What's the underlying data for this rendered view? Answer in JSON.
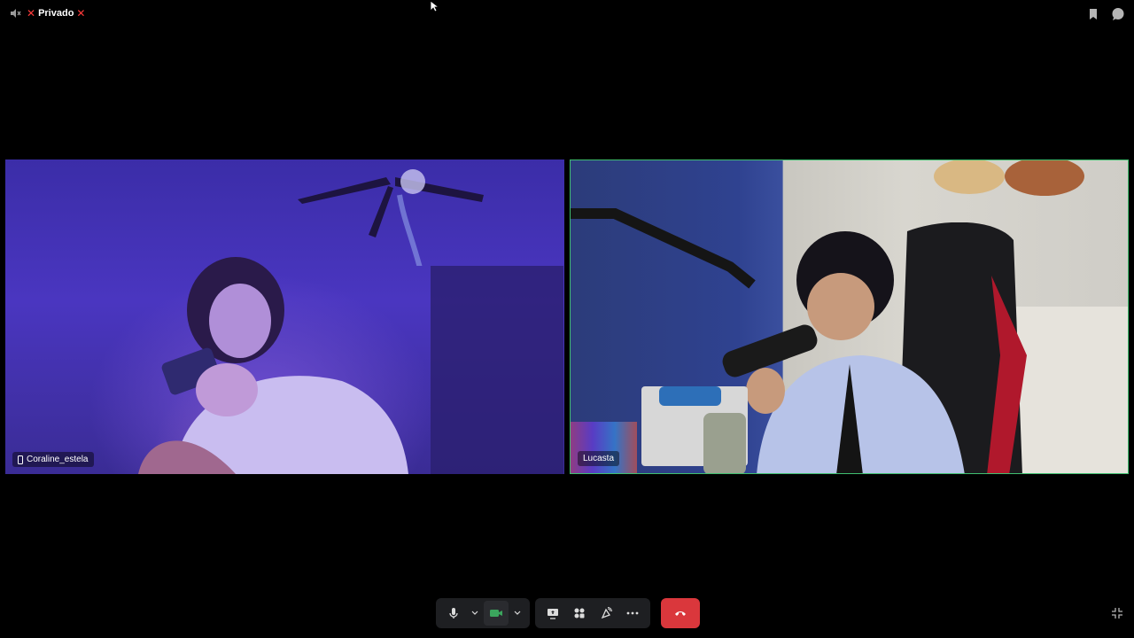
{
  "window": {
    "title": "Privado",
    "icons": {
      "volume": "volume-muted-icon",
      "bookmark": "bookmark-icon",
      "chat": "chat-bubble-icon",
      "fullscreen": "exit-fullscreen-icon"
    }
  },
  "participants": [
    {
      "name": "Coraline_estela",
      "device_icon": "mobile-phone-icon"
    },
    {
      "name": "Lucasta",
      "speaking_highlight": "#3fbf6f"
    }
  ],
  "controls": {
    "mic": "microphone-icon",
    "mic_options": "chevron-down-icon",
    "camera": "camera-icon",
    "camera_color": "#3ba55d",
    "camera_options": "chevron-down-icon",
    "screen_share": "screen-share-icon",
    "activities": "activities-icon",
    "soundboard": "soundboard-icon",
    "more": "more-options-icon",
    "disconnect": "hang-up-icon",
    "disconnect_color": "#da373c"
  },
  "colors": {
    "private_x": "#ff3b3b",
    "background": "#000000"
  }
}
